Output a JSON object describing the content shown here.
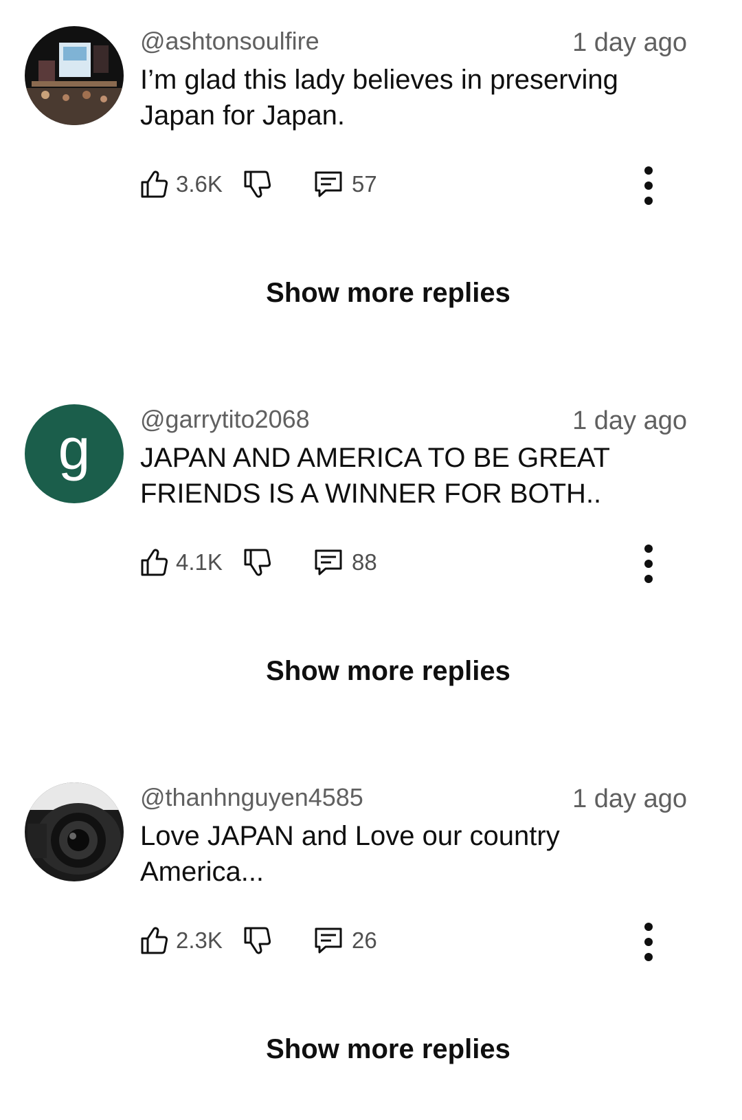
{
  "comments": [
    {
      "handle": "@ashtonsoulfire",
      "time": "1 day ago",
      "text_line1": "I’m glad this lady believes in preserving",
      "text_line2": "Japan for Japan.",
      "likes": "3.6K",
      "replies": "57",
      "avatar": "photo-night-street",
      "show_more": "Show more replies"
    },
    {
      "handle": "@garrytito2068",
      "time": "1 day ago",
      "text_line1": "JAPAN AND AMERICA TO BE GREAT",
      "text_line2": "FRIENDS IS  A WINNER FOR BOTH..",
      "likes": "4.1K",
      "replies": "88",
      "avatar_letter": "g",
      "avatar_color": "#1b5e4b",
      "show_more": "Show more replies"
    },
    {
      "handle": "@thanhnguyen4585",
      "time": "1 day ago",
      "text_line1": "Love JAPAN and Love our country",
      "text_line2": "America...",
      "likes": "2.3K",
      "replies": "26",
      "avatar": "photo-camera-lens",
      "show_more": "Show more replies"
    }
  ],
  "icons": {
    "like": "thumb-up-icon",
    "dislike": "thumb-down-icon",
    "reply": "comment-icon",
    "more": "more-vert-icon"
  }
}
